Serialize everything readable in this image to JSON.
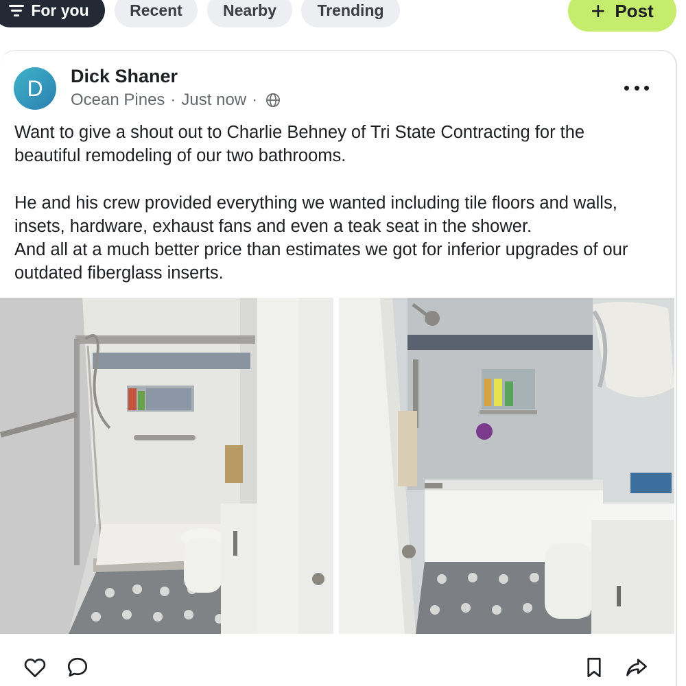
{
  "filters": {
    "for_you": "For you",
    "recent": "Recent",
    "nearby": "Nearby",
    "trending": "Trending",
    "post": "Post"
  },
  "post": {
    "avatar_letter": "D",
    "author": "Dick Shaner",
    "location": "Ocean Pines",
    "time": "Just now",
    "separator": "·",
    "text": {
      "line1": "Want to give a shout out to Charlie Behney of Tri State Contracting for the",
      "line2": "beautiful remodeling of our two bathrooms.",
      "line3": "He and his crew provided everything we wanted including tile floors and walls,",
      "line4": "insets, hardware, exhaust fans and even a teak seat in the shower.",
      "line5": "And all at a much better price than estimates we got for inferior upgrades of our",
      "line6": "outdated fiberglass inserts."
    }
  },
  "icons": {
    "filter": "filter-icon",
    "plus": "plus-icon",
    "globe": "globe-icon",
    "more": "more-icon",
    "like": "heart-icon",
    "comment": "comment-icon",
    "bookmark": "bookmark-icon",
    "share": "share-icon"
  },
  "colors": {
    "active_chip": "#232a36",
    "chip": "#eceef1",
    "post_button": "#c6ec6e",
    "avatar": "#2b7fb0",
    "meta_text": "#65686c"
  }
}
